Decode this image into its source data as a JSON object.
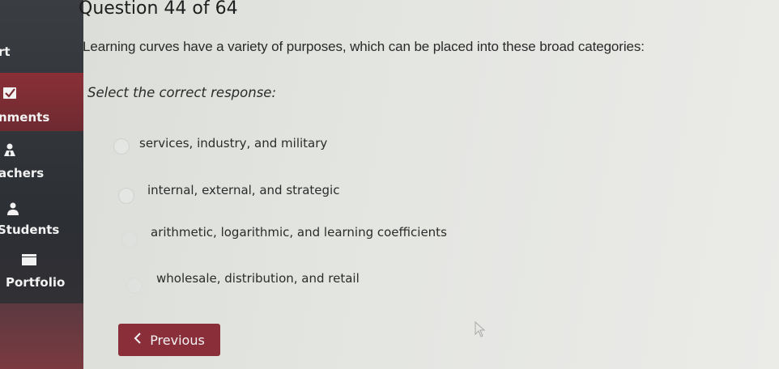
{
  "sidebar": {
    "items": [
      {
        "label": "rt",
        "icon": null
      },
      {
        "label": "nments",
        "icon": "checkmark-icon"
      },
      {
        "label": "achers",
        "icon": "teacher-icon"
      },
      {
        "label": "Students",
        "icon": "student-icon"
      },
      {
        "label": "Portfolio",
        "icon": "portfolio-icon"
      }
    ]
  },
  "header": {
    "title": "Question 44 of 64"
  },
  "question": {
    "text": "Learning curves have a variety of purposes, which can be placed into these broad categories:",
    "instruction": "Select the correct response:"
  },
  "options": [
    {
      "label": "services, industry, and military"
    },
    {
      "label": "internal, external, and strategic"
    },
    {
      "label": "arithmetic, logarithmic, and learning coefficients"
    },
    {
      "label": "wholesale, distribution, and retail"
    }
  ],
  "navigation": {
    "previous_label": "Previous"
  },
  "colors": {
    "accent": "#8a2f3a",
    "sidebar": "#2f3237"
  }
}
